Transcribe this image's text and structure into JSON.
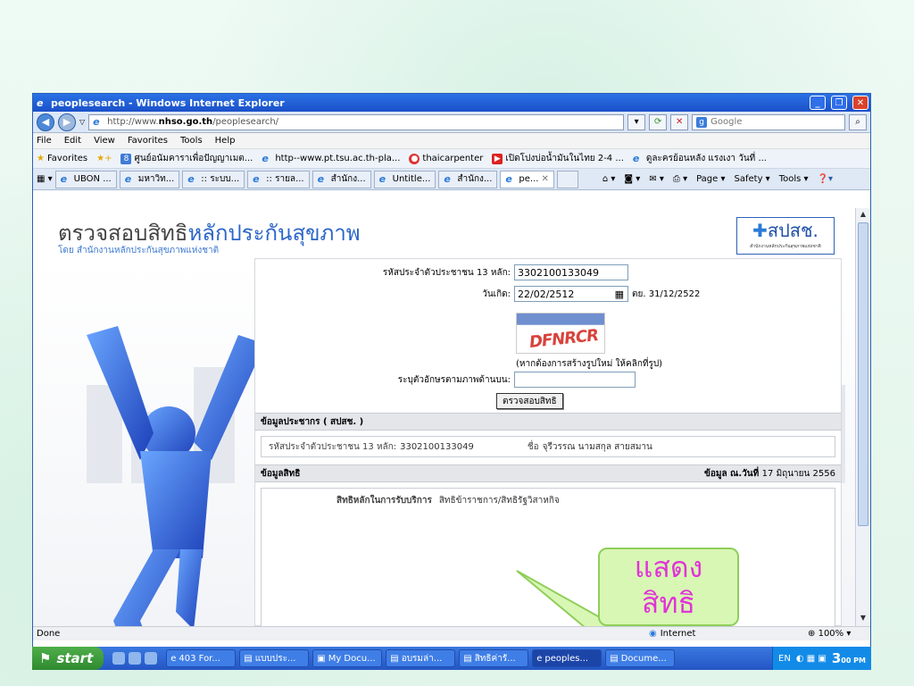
{
  "window": {
    "title": "peoplesearch - Windows Internet Explorer",
    "controls": [
      "_",
      "❐",
      "✕"
    ]
  },
  "address": {
    "url_prefix": "http://www.",
    "url_host": "nhso.go.th",
    "url_path": "/peoplesearch/",
    "search_placeholder": "Google"
  },
  "menu": [
    "File",
    "Edit",
    "View",
    "Favorites",
    "Tools",
    "Help"
  ],
  "favorites": {
    "label": "Favorites",
    "items": [
      "ศูนย์อนัมคาราเพื่อปัญญาเมต...",
      "http--www.pt.tsu.ac.th-pla...",
      "thaicarpenter",
      "เปิดโปงบ่อน้ำมันในไทย 2-4 ...",
      "ดูละครย้อนหลัง แรงเงา วันที่ ..."
    ]
  },
  "tabs": {
    "items": [
      "UBON ...",
      "มหาวิท...",
      ":: ระบบ...",
      ":: รายล...",
      "สำนักง...",
      "Untitle...",
      "สำนักง...",
      "pe..."
    ],
    "close": "✕",
    "tools": [
      "Page ▾",
      "Safety ▾",
      "Tools ▾"
    ]
  },
  "page": {
    "title_a": "ตรวจสอบสิทธิ",
    "title_b": "หลักประกันสุขภาพ",
    "subtitle": "โดย สำนักงานหลักประกันสุขภาพแห่งชาติ",
    "logo_main": "สปสช.",
    "logo_sub": "สำนักงานหลักประกันสุขภาพแห่งชาติ"
  },
  "form": {
    "id_label": "รหัสประจำตัวประชาชน 13 หลัก:",
    "id_value": "3302100133049",
    "dob_label": "วันเกิด:",
    "dob_value": "22/02/2512",
    "dob_hint": "ตย. 31/12/2522",
    "captcha_text": "DFNRCR",
    "captcha_hint": "(หากต้องการสร้างรูปใหม่ ให้คลิกที่รูป)",
    "code_label": "ระบุตัวอักษรตามภาพด้านบน:",
    "code_value": "",
    "submit": "ตรวจสอบสิทธิ"
  },
  "person": {
    "section": "ข้อมูลประชากร ( สปสช. )",
    "id_label": "รหัสประจำตัวประชาชน 13 หลัก:",
    "id_value": "3302100133049",
    "name_label": "ชื่อ",
    "name_value": "จุรีวรรณ นามสกุล สายสมาน"
  },
  "rights": {
    "section": "ข้อมูลสิทธิ",
    "date_label": "ข้อมูล ณ.วันที่",
    "date_value": "17 มิถุนายน 2556",
    "main_label": "สิทธิหลักในการรับบริการ",
    "main_value": "สิทธิข้าราชการ/สิทธิรัฐวิสาหกิจ"
  },
  "callout": {
    "line1": "แสดง",
    "line2": "สิทธิ"
  },
  "status": {
    "left": "Done",
    "zone": "Internet",
    "zoom": "100%"
  },
  "taskbar": {
    "start": "start",
    "tasks": [
      "403 For...",
      "แบบประ...",
      "My Docu...",
      "อบรมล่า...",
      "สิทธิค่ารั...",
      "peoples...",
      "Docume..."
    ],
    "lang": "EN",
    "time": "3",
    "time_small": "00 PM"
  },
  "colors": {
    "title_blue": "#2c66c8",
    "callout_text": "#e034d8",
    "callout_bg": "#d9f7b4"
  }
}
